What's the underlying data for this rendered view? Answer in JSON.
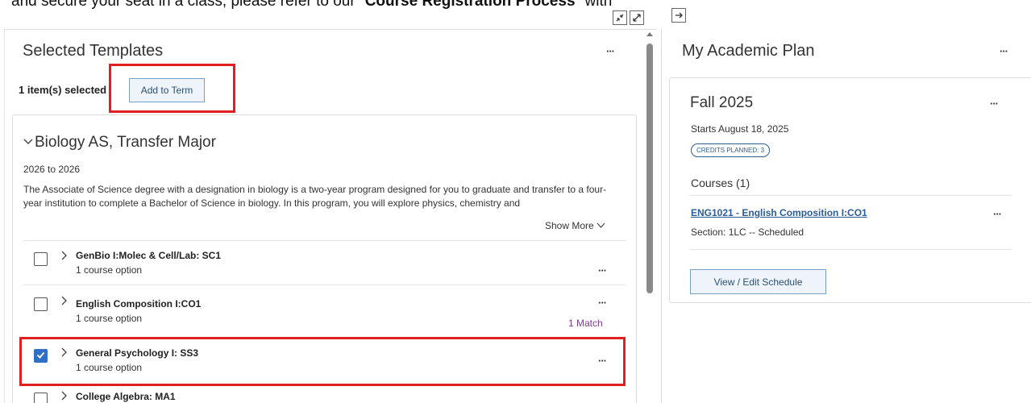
{
  "banner": {
    "text_prefix": "and secure your seat in a class, please refer to our \"",
    "text_bold": "Course Registration Process",
    "text_suffix": "\" with"
  },
  "toolbar": {
    "collapse_icon": "collapse-arrows-icon",
    "expand_icon": "expand-arrows-icon",
    "arrow_icon": "arrow-right-icon"
  },
  "selected_templates": {
    "title": "Selected Templates",
    "more_label": "···",
    "selected_count": "1 item(s) selected",
    "add_to_term": "Add to Term",
    "template": {
      "title": "Biology AS, Transfer Major",
      "years": "2026 to 2026",
      "description": "The Associate of Science degree with a designation in biology is a two-year program designed for you to graduate and transfer to a four-year institution to complete a Bachelor of Science in biology. In this program, you will explore physics, chemistry and",
      "show_more": "Show More"
    },
    "courses": [
      {
        "title": "GenBio I:Molec & Cell/Lab: SC1",
        "sub": "1 course option",
        "checked": false
      },
      {
        "title": "English Composition I:CO1",
        "sub": "1 course option",
        "checked": false,
        "match": "1 Match"
      },
      {
        "title": "General Psychology I: SS3",
        "sub": "1 course option",
        "checked": true
      },
      {
        "title": "College Algebra: MA1",
        "sub": "",
        "checked": false
      }
    ]
  },
  "academic_plan": {
    "title": "My Academic Plan",
    "more_label": "···",
    "term": {
      "title": "Fall 2025",
      "starts": "Starts August 18, 2025",
      "credits": "CREDITS PLANNED: 3",
      "courses_label": "Courses (1)",
      "course_link": "ENG1021 - English Composition I:CO1",
      "section": "Section: 1LC -- Scheduled",
      "view_edit": "View / Edit Schedule"
    }
  },
  "colors": {
    "highlight": "#e02020",
    "accent": "#2f6fc4",
    "match": "#7a3c8e"
  }
}
